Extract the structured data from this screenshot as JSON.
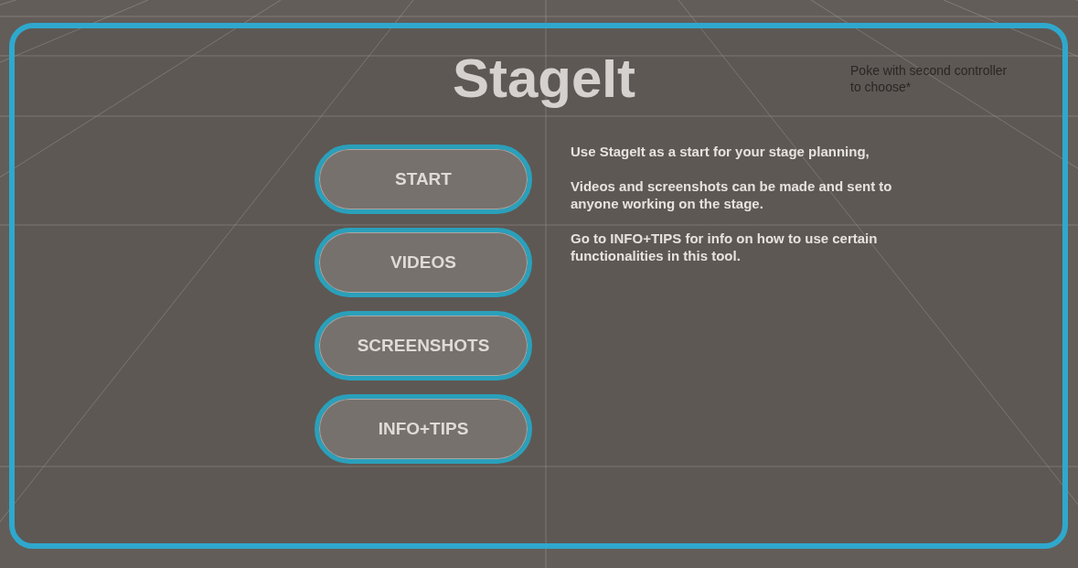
{
  "title": "StageIt",
  "hint": "Poke with second controller to choose*",
  "menu_buttons": [
    {
      "label": "START"
    },
    {
      "label": "VIDEOS"
    },
    {
      "label": "SCREENSHOTS"
    },
    {
      "label": "INFO+TIPS"
    }
  ],
  "description": [
    "Use StageIt as a start for your stage planning,",
    "Videos and screenshots can be made and sent to anyone working on the stage.",
    "Go to INFO+TIPS for info on how to use certain functionalities in this tool."
  ]
}
